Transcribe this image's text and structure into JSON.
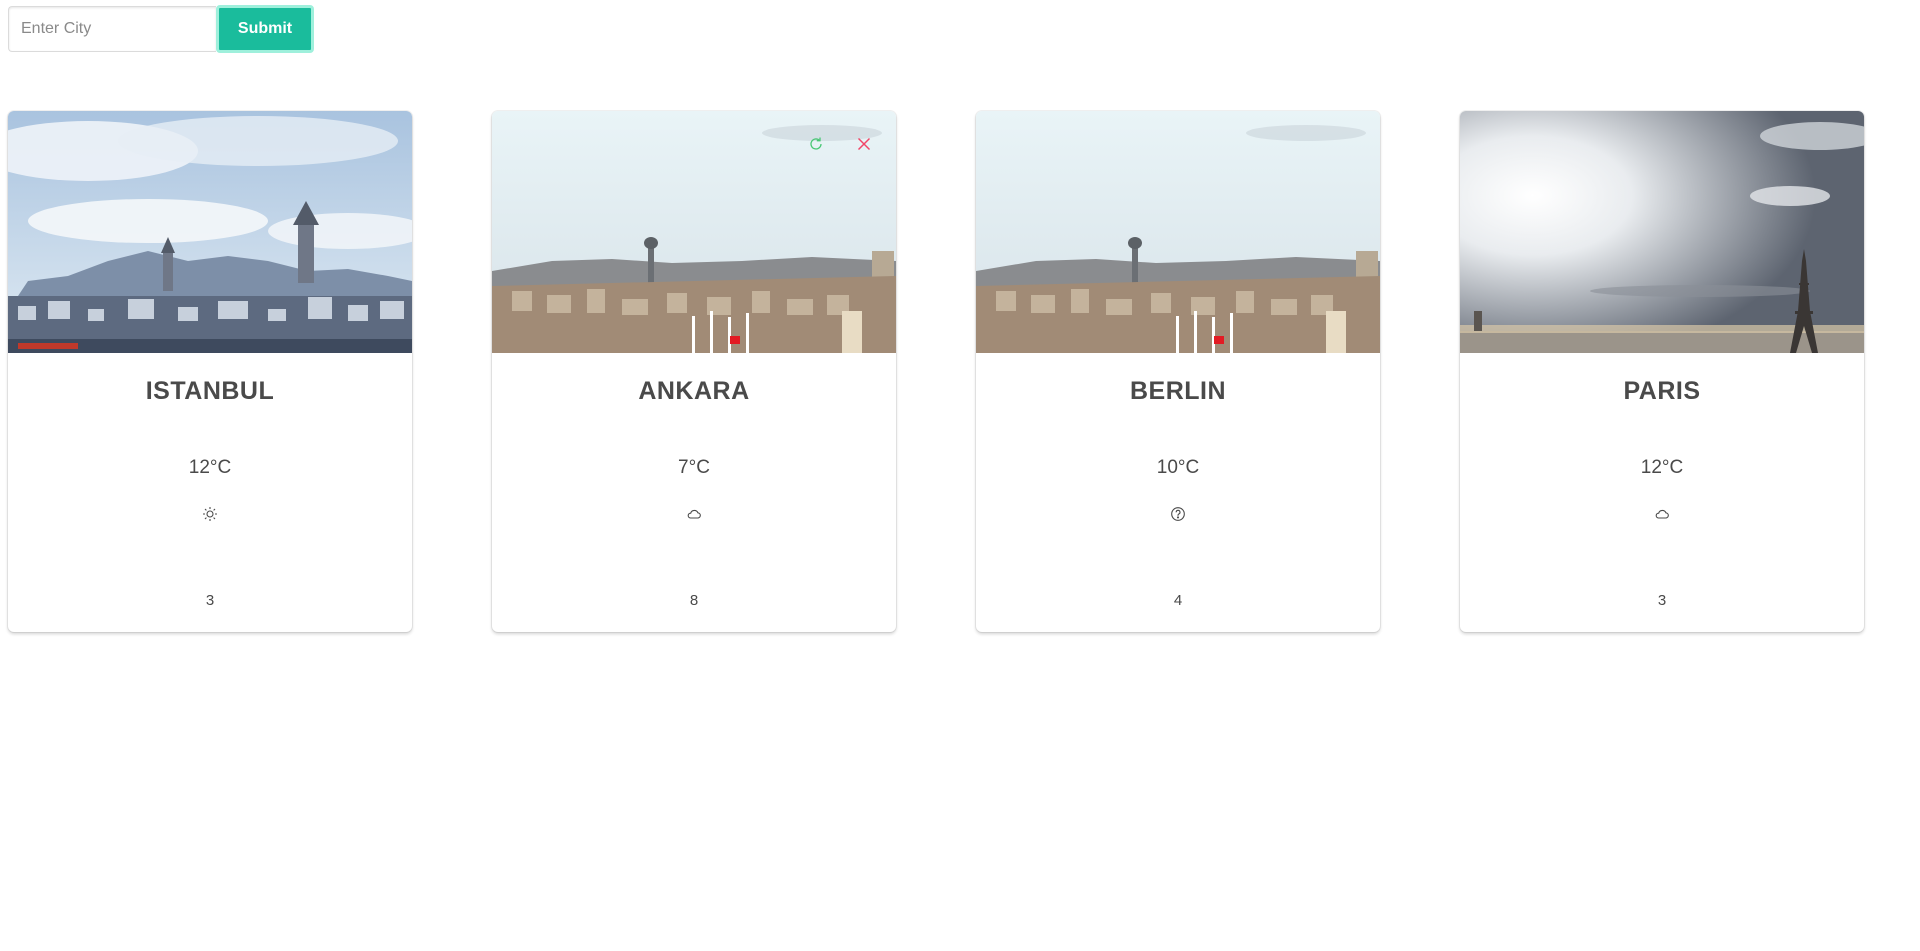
{
  "search": {
    "placeholder": "Enter City",
    "value": "",
    "submit_label": "Submit"
  },
  "colors": {
    "accent": "#1abc9c",
    "refresh": "#48c774",
    "delete": "#f14668",
    "text": "#4a4a4a"
  },
  "cards": [
    {
      "city": "ISTANBUL",
      "temperature": "12°C",
      "weather_icon": "sun-icon",
      "count": "3",
      "image": "istanbul-skyline",
      "show_actions": false
    },
    {
      "city": "ANKARA",
      "temperature": "7°C",
      "weather_icon": "cloud-icon",
      "count": "8",
      "image": "ankara-skyline",
      "show_actions": true
    },
    {
      "city": "BERLIN",
      "temperature": "10°C",
      "weather_icon": "question-circle-icon",
      "count": "4",
      "image": "ankara-skyline",
      "show_actions": false
    },
    {
      "city": "PARIS",
      "temperature": "12°C",
      "weather_icon": "cloud-icon",
      "count": "3",
      "image": "paris-skyline",
      "show_actions": false
    }
  ]
}
